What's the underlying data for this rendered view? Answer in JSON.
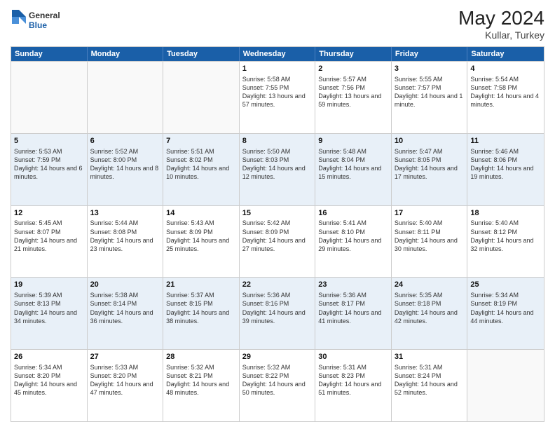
{
  "header": {
    "logo_general": "General",
    "logo_blue": "Blue",
    "title": "May 2024",
    "location": "Kullar, Turkey"
  },
  "days_of_week": [
    "Sunday",
    "Monday",
    "Tuesday",
    "Wednesday",
    "Thursday",
    "Friday",
    "Saturday"
  ],
  "rows": [
    {
      "alt": false,
      "cells": [
        {
          "day": "",
          "sunrise": "",
          "sunset": "",
          "daylight": ""
        },
        {
          "day": "",
          "sunrise": "",
          "sunset": "",
          "daylight": ""
        },
        {
          "day": "",
          "sunrise": "",
          "sunset": "",
          "daylight": ""
        },
        {
          "day": "1",
          "sunrise": "Sunrise: 5:58 AM",
          "sunset": "Sunset: 7:55 PM",
          "daylight": "Daylight: 13 hours and 57 minutes."
        },
        {
          "day": "2",
          "sunrise": "Sunrise: 5:57 AM",
          "sunset": "Sunset: 7:56 PM",
          "daylight": "Daylight: 13 hours and 59 minutes."
        },
        {
          "day": "3",
          "sunrise": "Sunrise: 5:55 AM",
          "sunset": "Sunset: 7:57 PM",
          "daylight": "Daylight: 14 hours and 1 minute."
        },
        {
          "day": "4",
          "sunrise": "Sunrise: 5:54 AM",
          "sunset": "Sunset: 7:58 PM",
          "daylight": "Daylight: 14 hours and 4 minutes."
        }
      ]
    },
    {
      "alt": true,
      "cells": [
        {
          "day": "5",
          "sunrise": "Sunrise: 5:53 AM",
          "sunset": "Sunset: 7:59 PM",
          "daylight": "Daylight: 14 hours and 6 minutes."
        },
        {
          "day": "6",
          "sunrise": "Sunrise: 5:52 AM",
          "sunset": "Sunset: 8:00 PM",
          "daylight": "Daylight: 14 hours and 8 minutes."
        },
        {
          "day": "7",
          "sunrise": "Sunrise: 5:51 AM",
          "sunset": "Sunset: 8:02 PM",
          "daylight": "Daylight: 14 hours and 10 minutes."
        },
        {
          "day": "8",
          "sunrise": "Sunrise: 5:50 AM",
          "sunset": "Sunset: 8:03 PM",
          "daylight": "Daylight: 14 hours and 12 minutes."
        },
        {
          "day": "9",
          "sunrise": "Sunrise: 5:48 AM",
          "sunset": "Sunset: 8:04 PM",
          "daylight": "Daylight: 14 hours and 15 minutes."
        },
        {
          "day": "10",
          "sunrise": "Sunrise: 5:47 AM",
          "sunset": "Sunset: 8:05 PM",
          "daylight": "Daylight: 14 hours and 17 minutes."
        },
        {
          "day": "11",
          "sunrise": "Sunrise: 5:46 AM",
          "sunset": "Sunset: 8:06 PM",
          "daylight": "Daylight: 14 hours and 19 minutes."
        }
      ]
    },
    {
      "alt": false,
      "cells": [
        {
          "day": "12",
          "sunrise": "Sunrise: 5:45 AM",
          "sunset": "Sunset: 8:07 PM",
          "daylight": "Daylight: 14 hours and 21 minutes."
        },
        {
          "day": "13",
          "sunrise": "Sunrise: 5:44 AM",
          "sunset": "Sunset: 8:08 PM",
          "daylight": "Daylight: 14 hours and 23 minutes."
        },
        {
          "day": "14",
          "sunrise": "Sunrise: 5:43 AM",
          "sunset": "Sunset: 8:09 PM",
          "daylight": "Daylight: 14 hours and 25 minutes."
        },
        {
          "day": "15",
          "sunrise": "Sunrise: 5:42 AM",
          "sunset": "Sunset: 8:09 PM",
          "daylight": "Daylight: 14 hours and 27 minutes."
        },
        {
          "day": "16",
          "sunrise": "Sunrise: 5:41 AM",
          "sunset": "Sunset: 8:10 PM",
          "daylight": "Daylight: 14 hours and 29 minutes."
        },
        {
          "day": "17",
          "sunrise": "Sunrise: 5:40 AM",
          "sunset": "Sunset: 8:11 PM",
          "daylight": "Daylight: 14 hours and 30 minutes."
        },
        {
          "day": "18",
          "sunrise": "Sunrise: 5:40 AM",
          "sunset": "Sunset: 8:12 PM",
          "daylight": "Daylight: 14 hours and 32 minutes."
        }
      ]
    },
    {
      "alt": true,
      "cells": [
        {
          "day": "19",
          "sunrise": "Sunrise: 5:39 AM",
          "sunset": "Sunset: 8:13 PM",
          "daylight": "Daylight: 14 hours and 34 minutes."
        },
        {
          "day": "20",
          "sunrise": "Sunrise: 5:38 AM",
          "sunset": "Sunset: 8:14 PM",
          "daylight": "Daylight: 14 hours and 36 minutes."
        },
        {
          "day": "21",
          "sunrise": "Sunrise: 5:37 AM",
          "sunset": "Sunset: 8:15 PM",
          "daylight": "Daylight: 14 hours and 38 minutes."
        },
        {
          "day": "22",
          "sunrise": "Sunrise: 5:36 AM",
          "sunset": "Sunset: 8:16 PM",
          "daylight": "Daylight: 14 hours and 39 minutes."
        },
        {
          "day": "23",
          "sunrise": "Sunrise: 5:36 AM",
          "sunset": "Sunset: 8:17 PM",
          "daylight": "Daylight: 14 hours and 41 minutes."
        },
        {
          "day": "24",
          "sunrise": "Sunrise: 5:35 AM",
          "sunset": "Sunset: 8:18 PM",
          "daylight": "Daylight: 14 hours and 42 minutes."
        },
        {
          "day": "25",
          "sunrise": "Sunrise: 5:34 AM",
          "sunset": "Sunset: 8:19 PM",
          "daylight": "Daylight: 14 hours and 44 minutes."
        }
      ]
    },
    {
      "alt": false,
      "cells": [
        {
          "day": "26",
          "sunrise": "Sunrise: 5:34 AM",
          "sunset": "Sunset: 8:20 PM",
          "daylight": "Daylight: 14 hours and 45 minutes."
        },
        {
          "day": "27",
          "sunrise": "Sunrise: 5:33 AM",
          "sunset": "Sunset: 8:20 PM",
          "daylight": "Daylight: 14 hours and 47 minutes."
        },
        {
          "day": "28",
          "sunrise": "Sunrise: 5:32 AM",
          "sunset": "Sunset: 8:21 PM",
          "daylight": "Daylight: 14 hours and 48 minutes."
        },
        {
          "day": "29",
          "sunrise": "Sunrise: 5:32 AM",
          "sunset": "Sunset: 8:22 PM",
          "daylight": "Daylight: 14 hours and 50 minutes."
        },
        {
          "day": "30",
          "sunrise": "Sunrise: 5:31 AM",
          "sunset": "Sunset: 8:23 PM",
          "daylight": "Daylight: 14 hours and 51 minutes."
        },
        {
          "day": "31",
          "sunrise": "Sunrise: 5:31 AM",
          "sunset": "Sunset: 8:24 PM",
          "daylight": "Daylight: 14 hours and 52 minutes."
        },
        {
          "day": "",
          "sunrise": "",
          "sunset": "",
          "daylight": ""
        }
      ]
    }
  ]
}
